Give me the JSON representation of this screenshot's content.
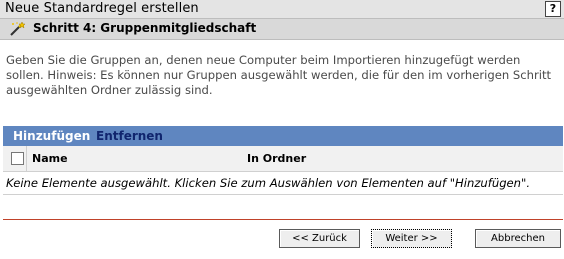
{
  "window": {
    "title": "Neue Standardregel erstellen",
    "help_label": "?"
  },
  "step": {
    "title": "Schritt 4: Gruppenmitgliedschaft",
    "icon": "magic-wand-icon"
  },
  "description": "Geben Sie die Gruppen an, denen neue Computer beim Importieren hinzugefügt werden sollen. Hinweis: Es können nur Gruppen ausgewählt werden, die für den im vorherigen Schritt ausgewählten Ordner zulässig sind.",
  "panel": {
    "add_label": "Hinzufügen",
    "remove_label": "Entfernen",
    "columns": [
      "Name",
      "In Ordner"
    ],
    "empty_message": "Keine Elemente ausgewählt. Klicken Sie zum Auswählen von Elementen auf \"Hinzufügen\"."
  },
  "buttons": {
    "back": "<< Zurück",
    "next": "Weiter >>",
    "cancel": "Abbrechen"
  },
  "colors": {
    "panel_header": "#5f86c0",
    "remove_link": "#10256e",
    "divider": "#c0422a"
  }
}
